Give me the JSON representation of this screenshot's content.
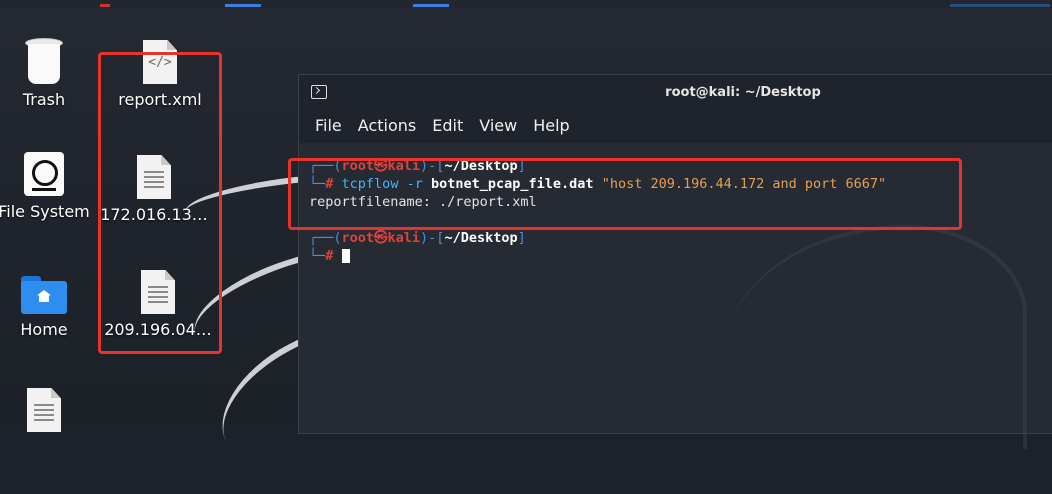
{
  "desktop": {
    "icons": [
      {
        "label": "Trash",
        "icon": "trash-icon"
      },
      {
        "label": "File System",
        "icon": "hard-drive-icon"
      },
      {
        "label": "Home",
        "icon": "home-folder-icon"
      },
      {
        "label": "report.xml",
        "icon": "xml-file-icon"
      },
      {
        "label": "172.016.13…",
        "icon": "text-file-icon"
      },
      {
        "label": "209.196.04…",
        "icon": "text-file-icon"
      }
    ],
    "highlight_color": "#e8322c"
  },
  "terminal": {
    "title": "root@kali: ~/Desktop",
    "menu": [
      "File",
      "Actions",
      "Edit",
      "View",
      "Help"
    ],
    "prompt": {
      "corner_top": "┌──(",
      "user": "root㉿kali",
      "mid": ")-[",
      "path": "~/Desktop",
      "end": "]",
      "corner_bottom": "└─",
      "hash": "#"
    },
    "command": {
      "program": "tcpflow",
      "flag": "-r",
      "file": "botnet_pcap_file.dat",
      "filter": "\"host 209.196.44.172 and port 6667\""
    },
    "output": "reportfilename: ./report.xml"
  }
}
